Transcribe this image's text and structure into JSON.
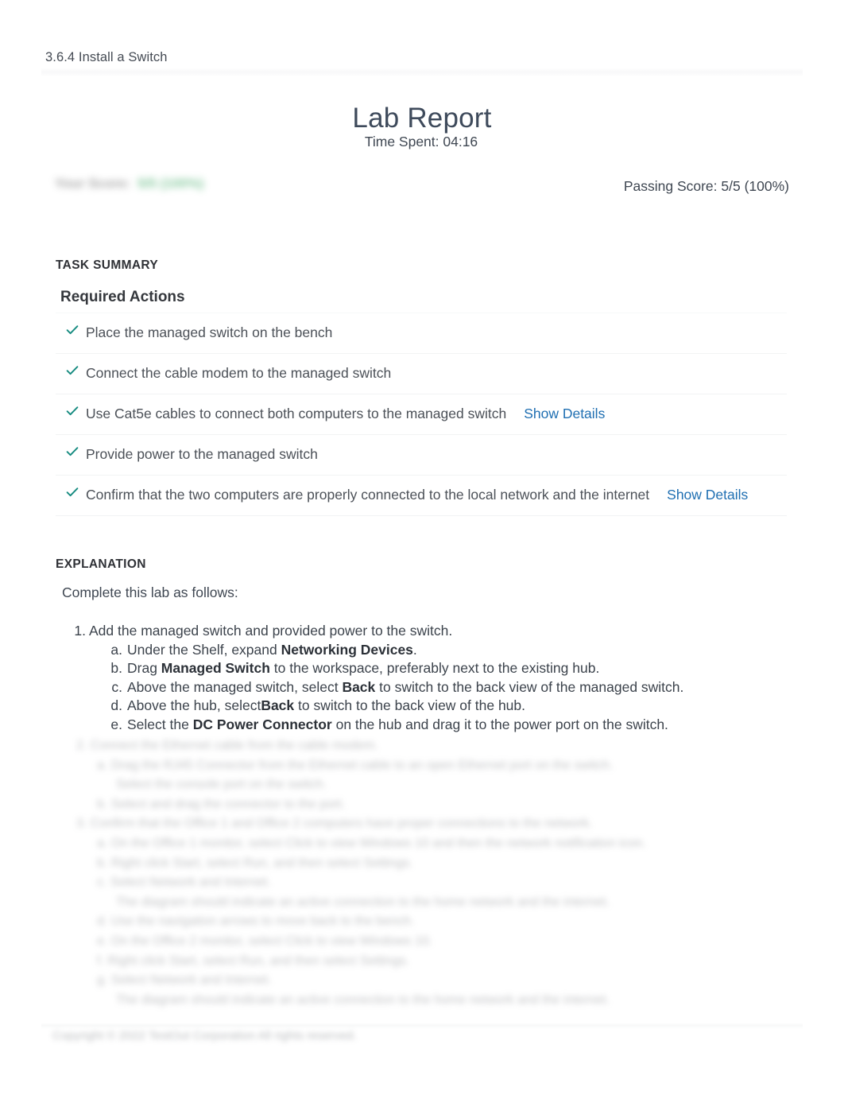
{
  "header": {
    "breadcrumb": "3.6.4 Install a Switch",
    "title": "Lab Report",
    "time_spent": "Time Spent: 04:16"
  },
  "score": {
    "your_score_redacted": "Your Score:",
    "your_score_value_redacted": "5/5 (100%)",
    "passing_score": "Passing Score: 5/5 (100%)"
  },
  "task_summary": {
    "label": "TASK SUMMARY",
    "subsection_title": "Required Actions",
    "items": [
      {
        "text": "Place the managed switch on the bench",
        "status": "complete",
        "details_link": ""
      },
      {
        "text": "Connect the cable modem to the managed switch",
        "status": "complete",
        "details_link": ""
      },
      {
        "text": "Use Cat5e cables to connect both computers to the managed switch",
        "status": "complete",
        "details_link": "Show Details"
      },
      {
        "text": "Provide power to the managed switch",
        "status": "complete",
        "details_link": ""
      },
      {
        "text": "Confirm that the two computers are properly connected to the local network and the internet",
        "status": "complete",
        "details_link": "Show Details"
      }
    ]
  },
  "explanation": {
    "label": "EXPLANATION",
    "intro": "Complete this lab as follows:",
    "steps": [
      {
        "marker": "1.",
        "text": "Add the managed switch and provided power to the switch.",
        "substeps": [
          {
            "marker": "a.",
            "parts": [
              {
                "t": "Under the Shelf, expand ",
                "bold": false
              },
              {
                "t": "Networking Devices",
                "bold": true
              },
              {
                "t": ".",
                "bold": false
              }
            ]
          },
          {
            "marker": "b.",
            "parts": [
              {
                "t": "Drag ",
                "bold": false
              },
              {
                "t": "Managed Switch",
                "bold": true
              },
              {
                "t": " to the workspace, preferably next to the existing hub.",
                "bold": false
              }
            ]
          },
          {
            "marker": "c.",
            "parts": [
              {
                "t": "Above the managed switch, select ",
                "bold": false
              },
              {
                "t": "Back",
                "bold": true
              },
              {
                "t": " to switch to the back view of the managed switch.",
                "bold": false
              }
            ]
          },
          {
            "marker": "d.",
            "parts": [
              {
                "t": "Above the hub, select",
                "bold": false
              },
              {
                "t": "Back",
                "bold": true
              },
              {
                "t": " to switch to the back view of the hub.",
                "bold": false
              }
            ]
          },
          {
            "marker": "e.",
            "parts": [
              {
                "t": "Select the ",
                "bold": false
              },
              {
                "t": "DC Power Connector",
                "bold": true
              },
              {
                "t": " on the hub and drag it to the power port on the switch.",
                "bold": false
              }
            ]
          }
        ]
      }
    ],
    "redacted_lines": [
      {
        "indent": "rstep",
        "text": "2. Connect the Ethernet cable from the cable modem."
      },
      {
        "indent": "rsub",
        "text": "a. Drag the RJ45 Connector from the Ethernet cable to an open Ethernet port on the switch."
      },
      {
        "indent": "rsub2",
        "text": "Select the console port on the switch."
      },
      {
        "indent": "rsub",
        "text": "b. Select and drag the connector to the port."
      },
      {
        "indent": "rstep",
        "text": "3. Confirm that the Office 1 and Office 2 computers have proper connections to the network."
      },
      {
        "indent": "rsub",
        "text": "a. On the Office 1 monitor, select Click to view Windows 10 and then the network notification icon."
      },
      {
        "indent": "rsub",
        "text": "b. Right click Start, select Run, and then select Settings."
      },
      {
        "indent": "rsub",
        "text": "c. Select Network and Internet."
      },
      {
        "indent": "rsub2",
        "text": "The diagram should indicate an active connection to the home network and the internet."
      },
      {
        "indent": "rsub",
        "text": "d. Use the navigation arrows to move back to the bench."
      },
      {
        "indent": "rsub",
        "text": "e. On the Office 2 monitor, select Click to view Windows 10."
      },
      {
        "indent": "rsub",
        "text": "f. Right click Start, select Run, and then select Settings."
      },
      {
        "indent": "rsub",
        "text": "g. Select Network and Internet."
      },
      {
        "indent": "rsub2",
        "text": "The diagram should indicate an active connection to the home network and the internet."
      }
    ]
  },
  "footer": {
    "copyright": "Copyright © 2022 TestOut Corporation All rights reserved."
  },
  "colors": {
    "check": "#168b80",
    "link": "#1f6fb2",
    "title": "#3e4a5b",
    "text": "#4c5158",
    "score_green": "#3aa761"
  }
}
